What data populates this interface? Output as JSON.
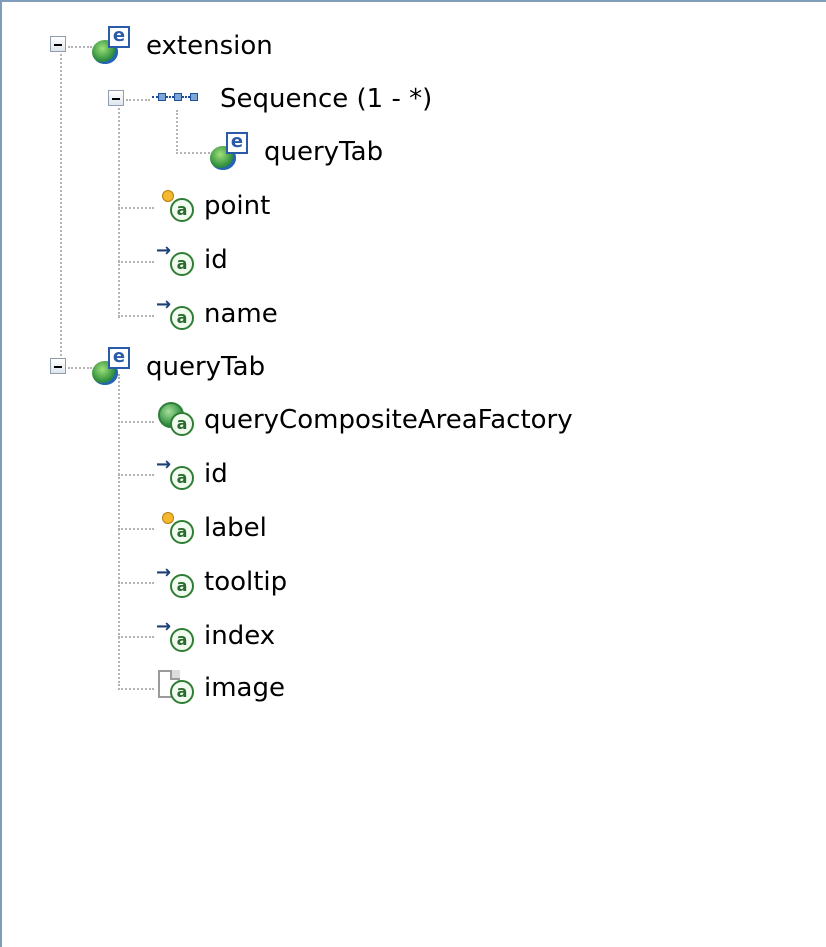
{
  "tree": {
    "extension": {
      "label": "extension",
      "icon": "element-icon",
      "expanded": true,
      "sequence": {
        "label": "Sequence (1 - *)",
        "icon": "sequence-icon",
        "expanded": true,
        "child": {
          "label": "queryTab",
          "icon": "element-icon"
        }
      },
      "attributes": [
        {
          "label": "point",
          "icon": "required-attribute-icon"
        },
        {
          "label": "id",
          "icon": "optional-attribute-icon"
        },
        {
          "label": "name",
          "icon": "optional-attribute-icon"
        }
      ]
    },
    "queryTab": {
      "label": "queryTab",
      "icon": "element-icon",
      "expanded": true,
      "attributes": [
        {
          "label": "queryCompositeAreaFactory",
          "icon": "class-attribute-icon"
        },
        {
          "label": "id",
          "icon": "optional-attribute-icon"
        },
        {
          "label": "label",
          "icon": "required-attribute-icon"
        },
        {
          "label": "tooltip",
          "icon": "optional-attribute-icon"
        },
        {
          "label": "index",
          "icon": "optional-attribute-icon"
        },
        {
          "label": "image",
          "icon": "resource-attribute-icon"
        }
      ]
    }
  },
  "colors": {
    "border": "#7f9db9",
    "connector": "#b3b3b3",
    "attribute_green": "#2f7d34",
    "element_blue": "#2a5ba8"
  }
}
